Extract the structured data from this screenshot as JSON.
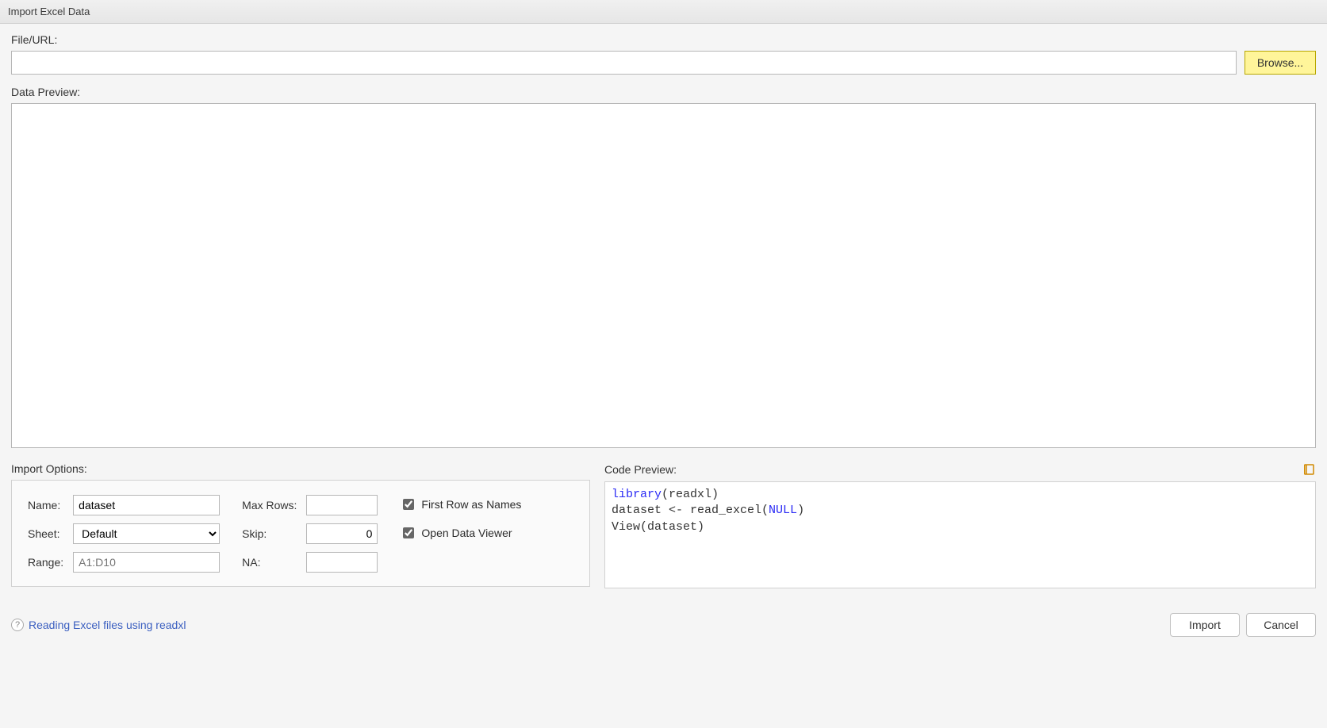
{
  "title": "Import Excel Data",
  "file_section": {
    "label": "File/URL:",
    "value": "",
    "browse_label": "Browse..."
  },
  "preview": {
    "label": "Data Preview:"
  },
  "options": {
    "label": "Import Options:",
    "name_label": "Name:",
    "name_value": "dataset",
    "sheet_label": "Sheet:",
    "sheet_value": "Default",
    "range_label": "Range:",
    "range_placeholder": "A1:D10",
    "range_value": "",
    "maxrows_label": "Max Rows:",
    "maxrows_value": "",
    "skip_label": "Skip:",
    "skip_value": "0",
    "na_label": "NA:",
    "na_value": "",
    "first_row_label": "First Row as Names",
    "first_row_checked": true,
    "open_viewer_label": "Open Data Viewer",
    "open_viewer_checked": true
  },
  "code": {
    "label": "Code Preview:",
    "lines": {
      "l1_a": "library",
      "l1_b": "(readxl)",
      "l2_a": "dataset <- read_excel(",
      "l2_b": "NULL",
      "l2_c": ")",
      "l3": "View(dataset)"
    }
  },
  "help": {
    "text": "Reading Excel files using readxl"
  },
  "footer": {
    "import_label": "Import",
    "cancel_label": "Cancel"
  }
}
